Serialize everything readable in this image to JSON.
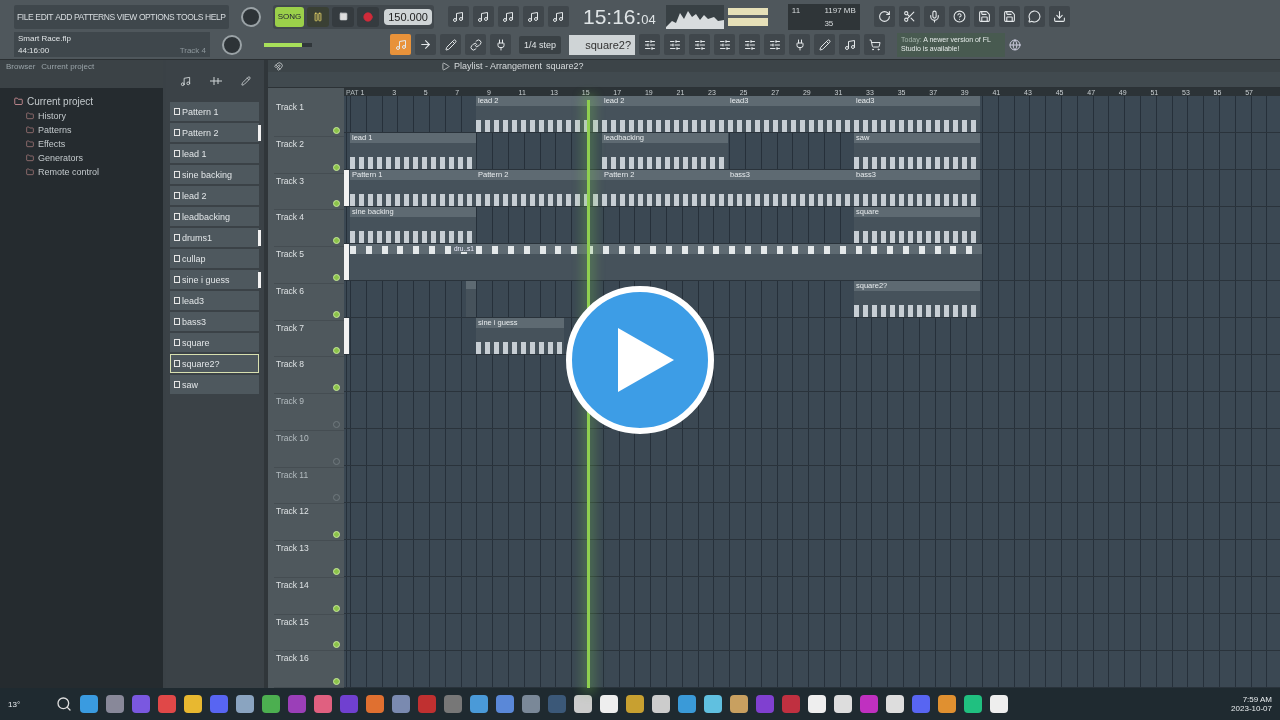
{
  "menu": [
    "FILE",
    "EDIT",
    "ADD",
    "PATTERNS",
    "VIEW",
    "OPTIONS",
    "TOOLS",
    "HELP"
  ],
  "project": {
    "file": "Smart Race.flp",
    "position": "44:16:00",
    "hint": "Track 4"
  },
  "transport": {
    "mode": "SONG",
    "song_mode": true,
    "playing": true,
    "tempo": "150.000"
  },
  "master_volume": {
    "level": 0.8
  },
  "clock": {
    "main": "15:16:",
    "sub": "04"
  },
  "monitor": {
    "voices": "11",
    "memory": "1197 MB",
    "cpu": "35"
  },
  "snap": "1/4 step",
  "current_pattern": "square2?",
  "news": {
    "prefix": "Today:",
    "text": "A newer version of FL Studio is available!"
  },
  "browser": {
    "title": "Browser",
    "location": "Current project",
    "tree": [
      {
        "label": "Current project",
        "children": [
          {
            "label": "History"
          },
          {
            "label": "Patterns"
          },
          {
            "label": "Effects"
          },
          {
            "label": "Generators"
          },
          {
            "label": "Remote control"
          }
        ]
      }
    ]
  },
  "patterns": [
    {
      "label": "Pattern 1",
      "selected": false,
      "marked": false
    },
    {
      "label": "Pattern 2",
      "selected": false,
      "marked": true
    },
    {
      "label": "lead 1",
      "selected": false,
      "marked": false
    },
    {
      "label": "sine backing",
      "selected": false,
      "marked": false
    },
    {
      "label": "lead 2",
      "selected": false,
      "marked": false
    },
    {
      "label": "leadbacking",
      "selected": false,
      "marked": false
    },
    {
      "label": "drums1",
      "selected": false,
      "marked": true
    },
    {
      "label": "cullap",
      "selected": false,
      "marked": false
    },
    {
      "label": "sine i guess",
      "selected": false,
      "marked": true
    },
    {
      "label": "lead3",
      "selected": false,
      "marked": false
    },
    {
      "label": "bass3",
      "selected": false,
      "marked": false
    },
    {
      "label": "square",
      "selected": false,
      "marked": false
    },
    {
      "label": "square2?",
      "selected": true,
      "marked": false
    },
    {
      "label": "saw",
      "selected": false,
      "marked": false
    }
  ],
  "playlist": {
    "title": "Playlist - Arrangement",
    "pattern": "square2?",
    "ruler_label": "PAT",
    "ruler": [
      "1",
      "3",
      "5",
      "7",
      "9",
      "11",
      "13",
      "15",
      "17",
      "19",
      "21",
      "23",
      "25",
      "27",
      "29",
      "31",
      "33",
      "35",
      "37",
      "39",
      "41",
      "43",
      "45",
      "47",
      "49",
      "51",
      "53",
      "55",
      "57"
    ],
    "tracks": [
      {
        "name": "Track 1",
        "enabled": true,
        "marked": false,
        "clips": [
          {
            "kind": "empty"
          },
          {
            "kind": "clip",
            "label": "lead 2"
          },
          {
            "kind": "clip",
            "label": "lead 2"
          },
          {
            "kind": "clip",
            "label": "lead3"
          },
          {
            "kind": "clip",
            "label": "lead3"
          }
        ]
      },
      {
        "name": "Track 2",
        "enabled": true,
        "marked": false,
        "clips": [
          {
            "kind": "clip",
            "label": "lead 1"
          },
          {
            "kind": "empty"
          },
          {
            "kind": "clip",
            "label": "leadbacking"
          },
          {
            "kind": "empty"
          },
          {
            "kind": "clip",
            "label": "saw"
          }
        ]
      },
      {
        "name": "Track 3",
        "enabled": true,
        "marked": true,
        "clips": [
          {
            "kind": "clip",
            "label": "Pattern 1"
          },
          {
            "kind": "clip",
            "label": "Pattern 2"
          },
          {
            "kind": "clip",
            "label": "Pattern 2"
          },
          {
            "kind": "clip",
            "label": "bass3"
          },
          {
            "kind": "clip",
            "label": "bass3"
          }
        ]
      },
      {
        "name": "Track 4",
        "enabled": true,
        "marked": false,
        "clips": [
          {
            "kind": "clip",
            "label": "sine backing"
          },
          {
            "kind": "empty"
          },
          {
            "kind": "empty"
          },
          {
            "kind": "empty"
          },
          {
            "kind": "clip",
            "label": "square"
          }
        ]
      },
      {
        "name": "Track 5",
        "enabled": true,
        "marked": true,
        "clips": [
          {
            "kind": "drums",
            "label": "dru..s1"
          }
        ]
      },
      {
        "name": "Track 6",
        "enabled": true,
        "marked": false,
        "clips": [
          {
            "kind": "stub"
          },
          {
            "kind": "empty"
          },
          {
            "kind": "empty"
          },
          {
            "kind": "empty"
          },
          {
            "kind": "clip",
            "label": "square2?"
          }
        ]
      },
      {
        "name": "Track 7",
        "enabled": true,
        "marked": true,
        "clips": [
          {
            "kind": "empty"
          },
          {
            "kind": "wide",
            "label": "sine i guess"
          }
        ]
      },
      {
        "name": "Track 8",
        "enabled": true,
        "marked": false
      },
      {
        "name": "Track 9",
        "enabled": false,
        "marked": false
      },
      {
        "name": "Track 10",
        "enabled": false,
        "marked": false
      },
      {
        "name": "Track 11",
        "enabled": false,
        "marked": false
      },
      {
        "name": "Track 12",
        "enabled": true,
        "marked": false
      },
      {
        "name": "Track 13",
        "enabled": true,
        "marked": false
      },
      {
        "name": "Track 14",
        "enabled": true,
        "marked": false
      },
      {
        "name": "Track 15",
        "enabled": true,
        "marked": false
      },
      {
        "name": "Track 16",
        "enabled": true,
        "marked": false
      }
    ]
  },
  "taskbar": {
    "weather": "13°",
    "time": "7:59 AM",
    "date": "2023-10-07"
  }
}
